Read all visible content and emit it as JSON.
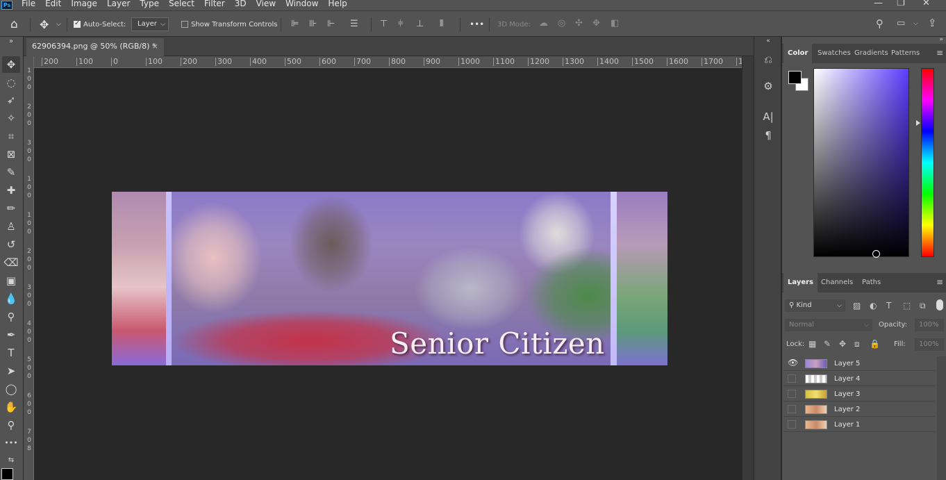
{
  "menu": [
    "File",
    "Edit",
    "Image",
    "Layer",
    "Type",
    "Select",
    "Filter",
    "3D",
    "View",
    "Window",
    "Help"
  ],
  "app_logo": "Ps",
  "window_controls": {
    "minimize": "—",
    "restore": "❐",
    "close": "✕"
  },
  "options": {
    "auto_select_label": "Auto-Select:",
    "auto_select_target": "Layer",
    "show_transform_label": "Show Transform Controls",
    "mode_3d_label": "3D Mode:",
    "more": "•••"
  },
  "document": {
    "tab_title": "62906394.png @ 50% (RGB/8) *",
    "close": "×"
  },
  "ruler": {
    "h_labels": [
      "200",
      "100",
      "0",
      "100",
      "200",
      "300",
      "400",
      "500",
      "600",
      "700",
      "800",
      "900",
      "1000",
      "1100",
      "1200",
      "1300",
      "1400",
      "1500",
      "1600",
      "1700",
      "1"
    ],
    "v_labels": [
      "1",
      "0",
      "0",
      "2",
      "0",
      "0",
      "3",
      "0",
      "0",
      "1",
      "0",
      "0",
      "1",
      "0",
      "0",
      "2",
      "0",
      "0",
      "3",
      "0",
      "0",
      "4",
      "0",
      "0",
      "5",
      "0",
      "0",
      "6",
      "0",
      "0",
      "7",
      "0",
      "8"
    ]
  },
  "canvas": {
    "headline": "Senior Citizen"
  },
  "color_panel": {
    "tabs": [
      "Color",
      "Swatches",
      "Gradients",
      "Patterns"
    ],
    "foreground": "#000000",
    "background": "#ffffff",
    "hue_color": "#5b3cff"
  },
  "layers_panel": {
    "tabs": [
      "Layers",
      "Channels",
      "Paths"
    ],
    "filter_kind": "Kind",
    "blend_mode": "Normal",
    "opacity_label": "Opacity:",
    "opacity_value": "100%",
    "lock_label": "Lock:",
    "fill_label": "Fill:",
    "fill_value": "100%",
    "layers": [
      {
        "name": "Layer 5",
        "visible": true
      },
      {
        "name": "Layer 4",
        "visible": false
      },
      {
        "name": "Layer 3",
        "visible": false
      },
      {
        "name": "Layer 2",
        "visible": false
      },
      {
        "name": "Layer 1",
        "visible": false
      }
    ]
  }
}
